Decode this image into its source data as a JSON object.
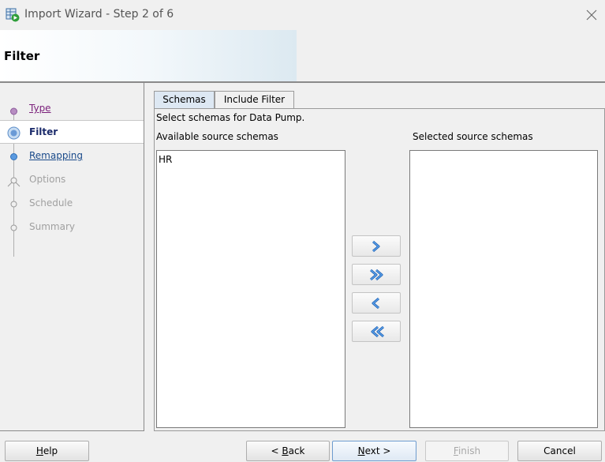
{
  "window": {
    "title": "Import Wizard - Step 2 of 6",
    "icon": "import-wizard-icon"
  },
  "header": {
    "title": "Filter"
  },
  "steps": [
    {
      "label": "Type",
      "state": "visited"
    },
    {
      "label": "Filter",
      "state": "current"
    },
    {
      "label": "Remapping",
      "state": "link"
    },
    {
      "label": "Options",
      "state": "disabled"
    },
    {
      "label": "Schedule",
      "state": "disabled"
    },
    {
      "label": "Summary",
      "state": "disabled"
    }
  ],
  "tabs": [
    {
      "label": "Schemas",
      "active": true
    },
    {
      "label": "Include Filter",
      "active": false
    }
  ],
  "content": {
    "description": "Select schemas for Data Pump.",
    "available_label": "Available source schemas",
    "selected_label": "Selected source schemas",
    "available_items": [
      "HR"
    ],
    "selected_items": []
  },
  "move_buttons": [
    {
      "name": "move-selected-right",
      "icon": "single-chevron-right-icon"
    },
    {
      "name": "move-all-right",
      "icon": "double-chevron-right-icon"
    },
    {
      "name": "move-selected-left",
      "icon": "single-chevron-left-icon"
    },
    {
      "name": "move-all-left",
      "icon": "double-chevron-left-icon"
    }
  ],
  "buttons": {
    "help": {
      "pre": "",
      "mnemonic": "H",
      "post": "elp"
    },
    "back": {
      "pre": "< ",
      "mnemonic": "B",
      "post": "ack"
    },
    "next": {
      "pre": "",
      "mnemonic": "N",
      "post": "ext >"
    },
    "finish": {
      "pre": "",
      "mnemonic": "F",
      "post": "inish"
    },
    "cancel": {
      "pre": "",
      "mnemonic": "",
      "post": "Cancel"
    }
  },
  "colors": {
    "visited_link": "#7a1f7a",
    "link": "#1a4a8a",
    "current_step": "#1a2a6a",
    "disabled": "#a0a0a0",
    "arrow_blue": "#2f7fd6"
  }
}
